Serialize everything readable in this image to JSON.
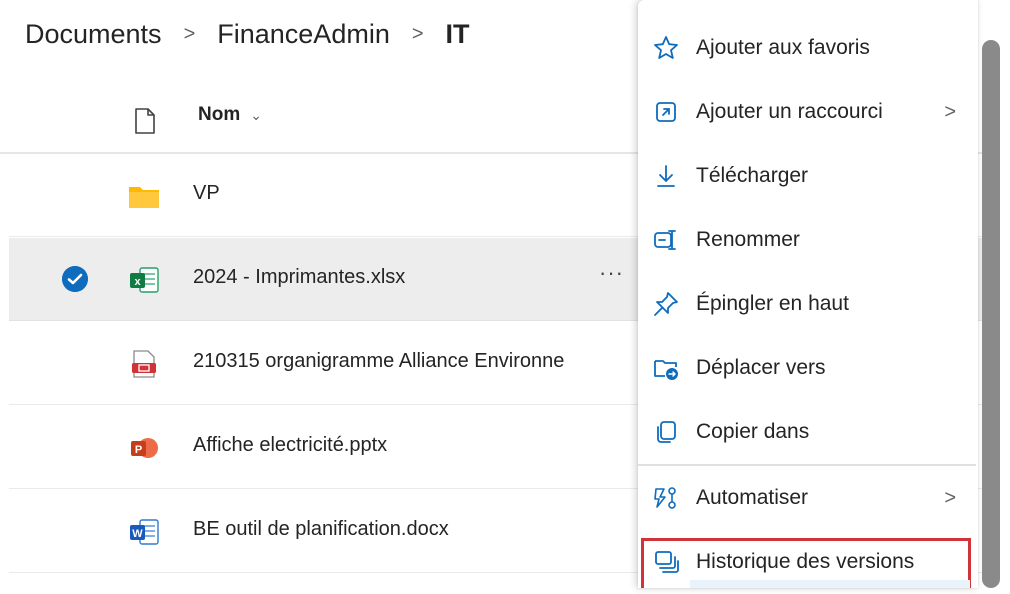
{
  "breadcrumb": {
    "items": [
      "Documents",
      "FinanceAdmin",
      "IT"
    ],
    "separator": ">"
  },
  "list": {
    "header": {
      "name_label": "Nom",
      "sort_icon": "chevron-down-icon"
    },
    "rows": [
      {
        "name": "VP",
        "icon": "folder-icon",
        "selected": false
      },
      {
        "name": "2024 - Imprimantes.xlsx",
        "icon": "excel-file-icon",
        "selected": true,
        "more": "···"
      },
      {
        "name": "210315 organigramme Alliance Environne",
        "icon": "pdf-file-icon",
        "selected": false
      },
      {
        "name": "Affiche electricité.pptx",
        "icon": "powerpoint-file-icon",
        "selected": false
      },
      {
        "name": "BE outil de planification.docx",
        "icon": "word-file-icon",
        "selected": false
      }
    ]
  },
  "context_menu": {
    "items": [
      {
        "label": "Ajouter aux favoris",
        "icon": "star-icon",
        "submenu": false
      },
      {
        "label": "Ajouter un raccourci",
        "icon": "shortcut-icon",
        "submenu": true
      },
      {
        "label": "Télécharger",
        "icon": "download-icon",
        "submenu": false
      },
      {
        "label": "Renommer",
        "icon": "rename-icon",
        "submenu": false
      },
      {
        "label": "Épingler en haut",
        "icon": "pin-icon",
        "submenu": false
      },
      {
        "label": "Déplacer vers",
        "icon": "move-folder-icon",
        "submenu": false
      },
      {
        "label": "Copier dans",
        "icon": "copy-icon",
        "submenu": false
      },
      {
        "label": "Automatiser",
        "icon": "automate-icon",
        "submenu": true
      },
      {
        "label": "Historique des versions",
        "icon": "version-history-icon",
        "submenu": false
      }
    ],
    "submenu_arrow": ">"
  },
  "colors": {
    "accent": "#0f6cbd",
    "highlight_border": "#d13438",
    "selected_row": "#ededed",
    "folder": "#ffb900",
    "excel": "#107c41",
    "powerpoint": "#c43e1c",
    "word": "#185abd",
    "pdf": "#d13438"
  }
}
